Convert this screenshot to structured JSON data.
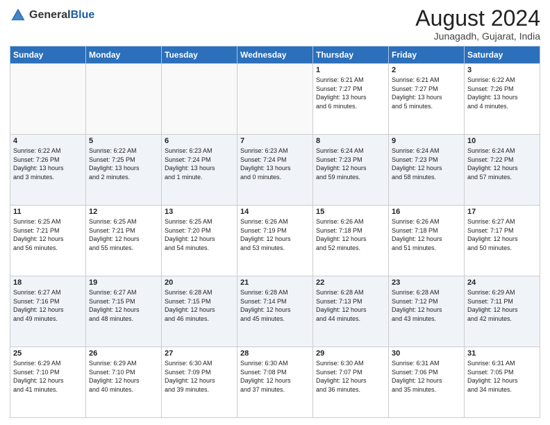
{
  "header": {
    "logo_general": "General",
    "logo_blue": "Blue",
    "month_title": "August 2024",
    "location": "Junagadh, Gujarat, India"
  },
  "days_of_week": [
    "Sunday",
    "Monday",
    "Tuesday",
    "Wednesday",
    "Thursday",
    "Friday",
    "Saturday"
  ],
  "weeks": [
    [
      {
        "num": "",
        "info": ""
      },
      {
        "num": "",
        "info": ""
      },
      {
        "num": "",
        "info": ""
      },
      {
        "num": "",
        "info": ""
      },
      {
        "num": "1",
        "info": "Sunrise: 6:21 AM\nSunset: 7:27 PM\nDaylight: 13 hours\nand 6 minutes."
      },
      {
        "num": "2",
        "info": "Sunrise: 6:21 AM\nSunset: 7:27 PM\nDaylight: 13 hours\nand 5 minutes."
      },
      {
        "num": "3",
        "info": "Sunrise: 6:22 AM\nSunset: 7:26 PM\nDaylight: 13 hours\nand 4 minutes."
      }
    ],
    [
      {
        "num": "4",
        "info": "Sunrise: 6:22 AM\nSunset: 7:26 PM\nDaylight: 13 hours\nand 3 minutes."
      },
      {
        "num": "5",
        "info": "Sunrise: 6:22 AM\nSunset: 7:25 PM\nDaylight: 13 hours\nand 2 minutes."
      },
      {
        "num": "6",
        "info": "Sunrise: 6:23 AM\nSunset: 7:24 PM\nDaylight: 13 hours\nand 1 minute."
      },
      {
        "num": "7",
        "info": "Sunrise: 6:23 AM\nSunset: 7:24 PM\nDaylight: 13 hours\nand 0 minutes."
      },
      {
        "num": "8",
        "info": "Sunrise: 6:24 AM\nSunset: 7:23 PM\nDaylight: 12 hours\nand 59 minutes."
      },
      {
        "num": "9",
        "info": "Sunrise: 6:24 AM\nSunset: 7:23 PM\nDaylight: 12 hours\nand 58 minutes."
      },
      {
        "num": "10",
        "info": "Sunrise: 6:24 AM\nSunset: 7:22 PM\nDaylight: 12 hours\nand 57 minutes."
      }
    ],
    [
      {
        "num": "11",
        "info": "Sunrise: 6:25 AM\nSunset: 7:21 PM\nDaylight: 12 hours\nand 56 minutes."
      },
      {
        "num": "12",
        "info": "Sunrise: 6:25 AM\nSunset: 7:21 PM\nDaylight: 12 hours\nand 55 minutes."
      },
      {
        "num": "13",
        "info": "Sunrise: 6:25 AM\nSunset: 7:20 PM\nDaylight: 12 hours\nand 54 minutes."
      },
      {
        "num": "14",
        "info": "Sunrise: 6:26 AM\nSunset: 7:19 PM\nDaylight: 12 hours\nand 53 minutes."
      },
      {
        "num": "15",
        "info": "Sunrise: 6:26 AM\nSunset: 7:18 PM\nDaylight: 12 hours\nand 52 minutes."
      },
      {
        "num": "16",
        "info": "Sunrise: 6:26 AM\nSunset: 7:18 PM\nDaylight: 12 hours\nand 51 minutes."
      },
      {
        "num": "17",
        "info": "Sunrise: 6:27 AM\nSunset: 7:17 PM\nDaylight: 12 hours\nand 50 minutes."
      }
    ],
    [
      {
        "num": "18",
        "info": "Sunrise: 6:27 AM\nSunset: 7:16 PM\nDaylight: 12 hours\nand 49 minutes."
      },
      {
        "num": "19",
        "info": "Sunrise: 6:27 AM\nSunset: 7:15 PM\nDaylight: 12 hours\nand 48 minutes."
      },
      {
        "num": "20",
        "info": "Sunrise: 6:28 AM\nSunset: 7:15 PM\nDaylight: 12 hours\nand 46 minutes."
      },
      {
        "num": "21",
        "info": "Sunrise: 6:28 AM\nSunset: 7:14 PM\nDaylight: 12 hours\nand 45 minutes."
      },
      {
        "num": "22",
        "info": "Sunrise: 6:28 AM\nSunset: 7:13 PM\nDaylight: 12 hours\nand 44 minutes."
      },
      {
        "num": "23",
        "info": "Sunrise: 6:28 AM\nSunset: 7:12 PM\nDaylight: 12 hours\nand 43 minutes."
      },
      {
        "num": "24",
        "info": "Sunrise: 6:29 AM\nSunset: 7:11 PM\nDaylight: 12 hours\nand 42 minutes."
      }
    ],
    [
      {
        "num": "25",
        "info": "Sunrise: 6:29 AM\nSunset: 7:10 PM\nDaylight: 12 hours\nand 41 minutes."
      },
      {
        "num": "26",
        "info": "Sunrise: 6:29 AM\nSunset: 7:10 PM\nDaylight: 12 hours\nand 40 minutes."
      },
      {
        "num": "27",
        "info": "Sunrise: 6:30 AM\nSunset: 7:09 PM\nDaylight: 12 hours\nand 39 minutes."
      },
      {
        "num": "28",
        "info": "Sunrise: 6:30 AM\nSunset: 7:08 PM\nDaylight: 12 hours\nand 37 minutes."
      },
      {
        "num": "29",
        "info": "Sunrise: 6:30 AM\nSunset: 7:07 PM\nDaylight: 12 hours\nand 36 minutes."
      },
      {
        "num": "30",
        "info": "Sunrise: 6:31 AM\nSunset: 7:06 PM\nDaylight: 12 hours\nand 35 minutes."
      },
      {
        "num": "31",
        "info": "Sunrise: 6:31 AM\nSunset: 7:05 PM\nDaylight: 12 hours\nand 34 minutes."
      }
    ]
  ]
}
